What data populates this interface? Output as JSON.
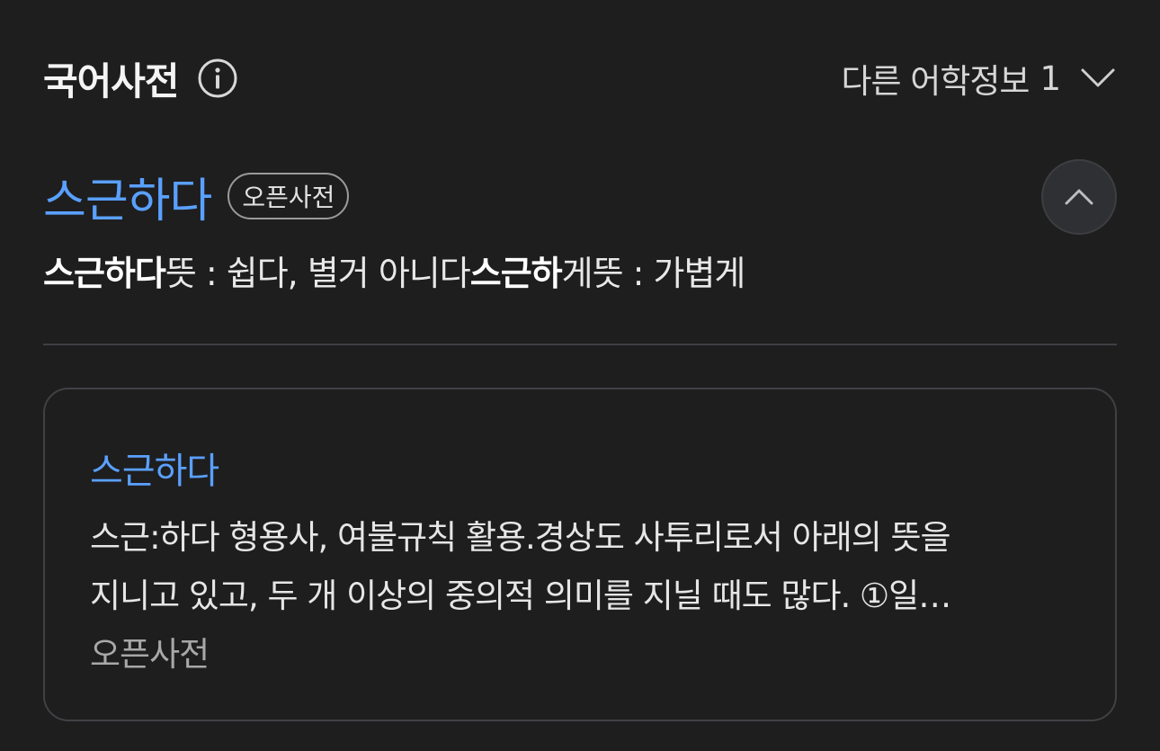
{
  "header": {
    "title": "국어사전",
    "other_info_label": "다른 어학정보",
    "other_info_count": "1"
  },
  "entry": {
    "headword": "스근하다",
    "source_badge": "오픈사전",
    "summary": {
      "term1": "스근하다",
      "meaning1": "뜻 : 쉽다, 별거 아니다",
      "term2": "스근하",
      "meaning2": "게뜻 : 가볍게"
    }
  },
  "card": {
    "title": "스근하다",
    "body_line1": "스근:하다 형용사, 여불규칙 활용.경상도 사투리로서 아래의 뜻을",
    "body_line2": "지니고 있고, 두 개 이상의 중의적 의미를 지닐 때도 많다. ①일…",
    "source": "오픈사전"
  },
  "colors": {
    "background": "#1e1e1f",
    "accent_blue": "#5aa0ff",
    "divider": "#3f3f42"
  },
  "icons": {
    "info": "info-circle-icon",
    "dropdown": "chevron-down-icon",
    "collapse": "chevron-up-icon"
  }
}
